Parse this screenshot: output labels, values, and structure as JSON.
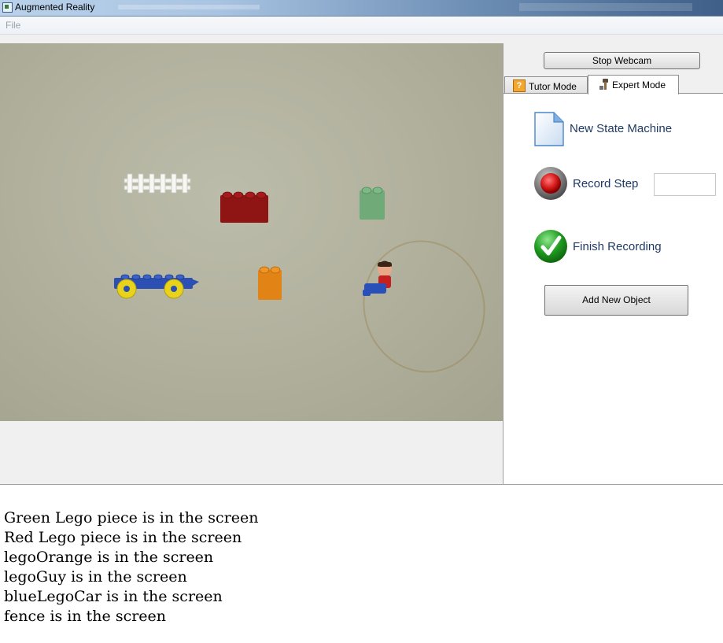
{
  "window": {
    "title": "Augmented Reality"
  },
  "menu": {
    "items": [
      "File"
    ]
  },
  "controls": {
    "stop_webcam_label": "Stop Webcam",
    "tabs": [
      {
        "label": "Tutor Mode",
        "icon": "question-icon",
        "active": false
      },
      {
        "label": "Expert Mode",
        "icon": "tools-icon",
        "active": true
      }
    ],
    "new_state_machine_label": "New State Machine",
    "record_step_label": "Record Step",
    "record_step_value": "",
    "finish_recording_label": "Finish Recording",
    "add_new_object_label": "Add New Object"
  },
  "webcam": {
    "objects": [
      "fence",
      "red-lego-brick",
      "green-lego-brick",
      "blue-lego-car",
      "orange-lego-brick",
      "lego-guy"
    ]
  },
  "status_log": [
    "Green Lego piece is in the screen",
    "Red Lego piece is in the screen",
    "legoOrange is in the screen",
    "legoGuy is in the screen",
    "blueLegoCar is in the screen",
    "fence is in the screen"
  ],
  "colors": {
    "record_red": "#d91d1d",
    "finish_green": "#1e9a1e",
    "document_blue": "#4a86c8",
    "label_text": "#1f3a63"
  }
}
